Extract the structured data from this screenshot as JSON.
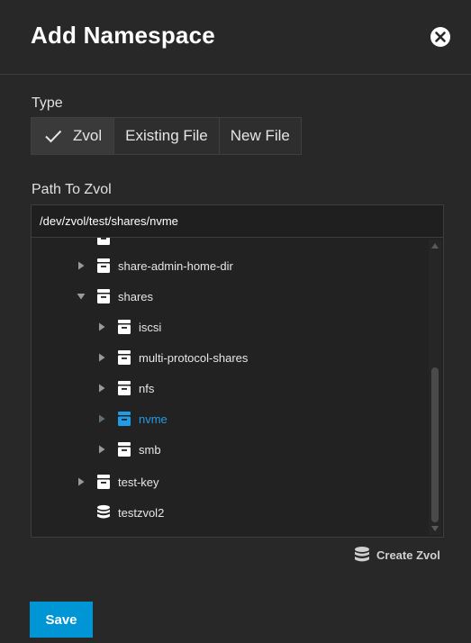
{
  "dialog": {
    "title": "Add Namespace",
    "close_icon": "close-circle-icon"
  },
  "type_section": {
    "label": "Type",
    "options": [
      {
        "label": "Zvol",
        "selected": true
      },
      {
        "label": "Existing File",
        "selected": false
      },
      {
        "label": "New File",
        "selected": false
      }
    ]
  },
  "path_section": {
    "label": "Path To Zvol",
    "value": "/dev/zvol/test/shares/nvme"
  },
  "tree": {
    "nodes": [
      {
        "label": "",
        "level": 1,
        "icon": "dataset-icon",
        "expandable": false,
        "partially_visible": true
      },
      {
        "label": "share-admin-home-dir",
        "level": 1,
        "icon": "dataset-icon",
        "expandable": true,
        "expanded": false
      },
      {
        "label": "shares",
        "level": 1,
        "icon": "dataset-icon",
        "expandable": true,
        "expanded": true
      },
      {
        "label": "iscsi",
        "level": 2,
        "icon": "dataset-icon",
        "expandable": true,
        "expanded": false
      },
      {
        "label": "multi-protocol-shares",
        "level": 2,
        "icon": "dataset-icon",
        "expandable": true,
        "expanded": false
      },
      {
        "label": "nfs",
        "level": 2,
        "icon": "dataset-icon",
        "expandable": true,
        "expanded": false
      },
      {
        "label": "nvme",
        "level": 2,
        "icon": "dataset-icon",
        "expandable": true,
        "expanded": false,
        "active": true
      },
      {
        "label": "smb",
        "level": 2,
        "icon": "dataset-icon",
        "expandable": true,
        "expanded": false
      },
      {
        "label": "test-key",
        "level": 1,
        "icon": "dataset-icon",
        "expandable": true,
        "expanded": false
      },
      {
        "label": "testzvol2",
        "level": 1,
        "icon": "zvol-icon",
        "expandable": false
      }
    ]
  },
  "actions": {
    "create_zvol_label": "Create Zvol",
    "save_label": "Save"
  },
  "colors": {
    "background": "#282828",
    "accent": "#0095d5",
    "active_node": "#1f9ce8"
  }
}
